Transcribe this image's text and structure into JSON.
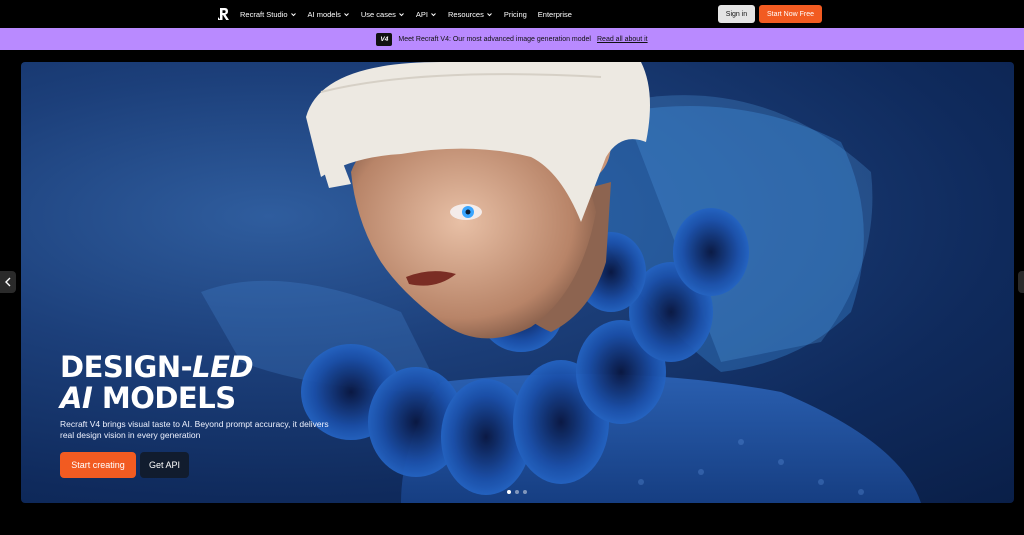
{
  "nav": {
    "logo_icon": "recraft-logo-icon",
    "items": [
      {
        "label": "Recraft Studio",
        "dropdown": true
      },
      {
        "label": "AI models",
        "dropdown": true
      },
      {
        "label": "Use cases",
        "dropdown": true
      },
      {
        "label": "API",
        "dropdown": true
      },
      {
        "label": "Resources",
        "dropdown": true
      },
      {
        "label": "Pricing",
        "dropdown": false
      },
      {
        "label": "Enterprise",
        "dropdown": false
      }
    ],
    "sign_in": "Sign in",
    "start_free": "Start Now Free"
  },
  "banner": {
    "badge": "V4",
    "text": "Meet Recraft V4: Our most advanced image generation model",
    "link": "Read all about it"
  },
  "hero": {
    "headline_line1_a": "DESIGN-",
    "headline_line1_b": "LED",
    "headline_line2_a": "AI",
    "headline_line2_b": "MODELS",
    "subtitle": "Recraft V4 brings visual taste to AI. Beyond prompt accuracy, it delivers real design vision in every generation",
    "cta_primary": "Start creating",
    "cta_secondary": "Get API",
    "slides": 3,
    "active_slide": 0
  },
  "colors": {
    "accent": "#f25b21",
    "banner": "#b98aff",
    "hero_blue": "#1c3f7a"
  }
}
